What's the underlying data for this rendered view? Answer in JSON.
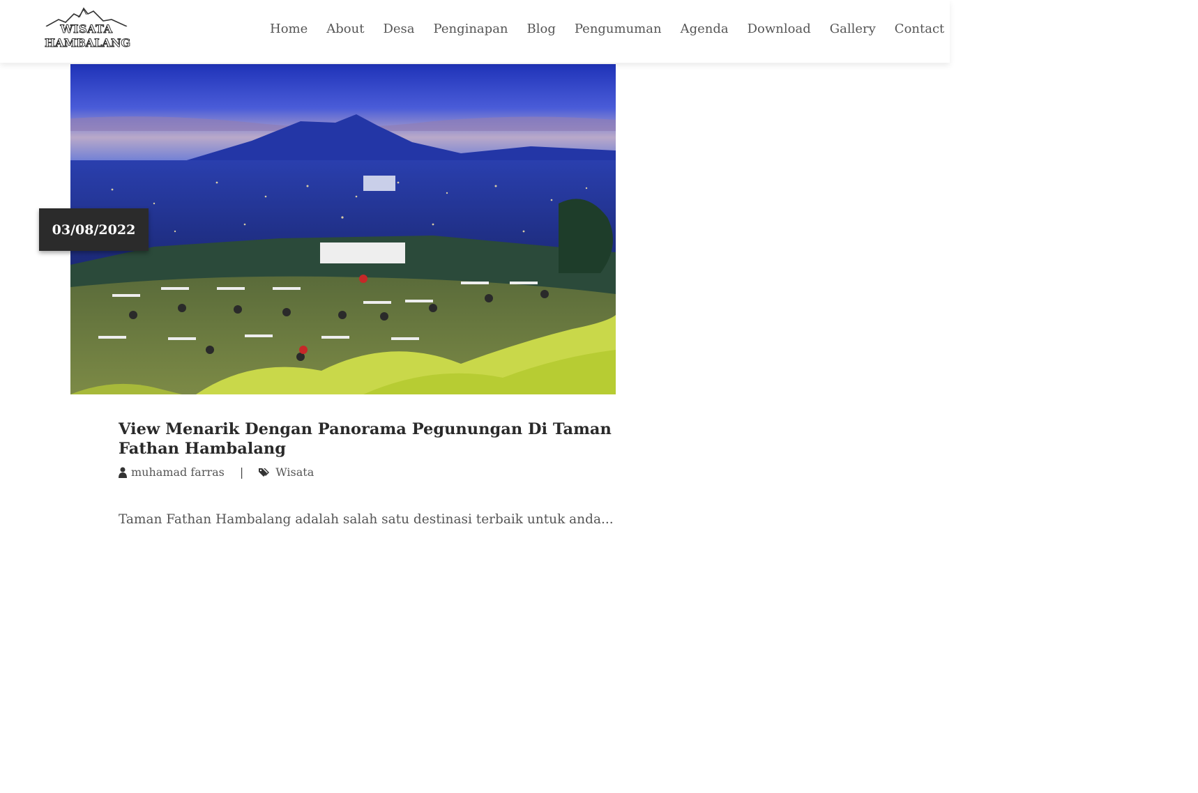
{
  "logo": {
    "line1": "WISATA",
    "line2": "HAMBALANG"
  },
  "nav": {
    "items": [
      "Home",
      "About",
      "Desa",
      "Penginapan",
      "Blog",
      "Pengumuman",
      "Agenda",
      "Download",
      "Gallery",
      "Contact"
    ]
  },
  "post": {
    "date": "03/08/2022",
    "title": "View Menarik Dengan Panorama Pegunungan Di Taman Fathan Hambalang",
    "author": "muhamad farras",
    "separator": "|",
    "category": "Wisata",
    "excerpt": "Taman Fathan Hambalang adalah salah satu destinasi terbaik untuk anda...",
    "image_icon": "landscape-photo"
  },
  "icons": {
    "author": "user-icon",
    "category": "tags-icon"
  },
  "colors": {
    "nav_text": "#555555",
    "badge_bg": "#2b2b2b",
    "title_text": "#2a2a2a"
  }
}
